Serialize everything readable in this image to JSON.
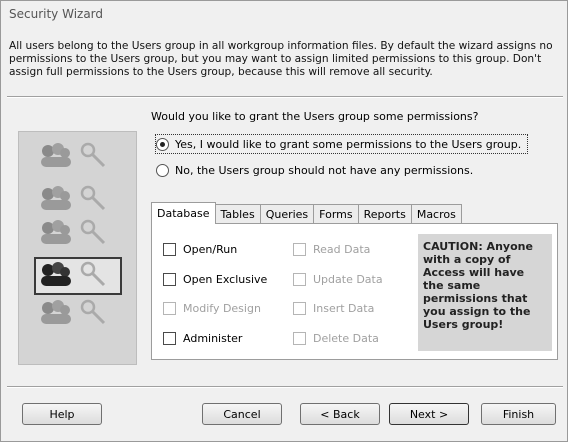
{
  "window": {
    "title": "Security Wizard"
  },
  "intro_text": "All users belong to the Users group in all workgroup information files. By default the wizard assigns no permissions to the Users group, but you may want to assign limited permissions to this group. Don't assign full permissions to the Users group, because this will remove all security.",
  "question": "Would you like to grant the Users group some permissions?",
  "options": {
    "yes": {
      "label": "Yes, I would like to grant some permissions to the Users group.",
      "selected": true
    },
    "no": {
      "label": "No, the Users group should not have any permissions.",
      "selected": false
    }
  },
  "tabs": [
    "Database",
    "Tables",
    "Queries",
    "Forms",
    "Reports",
    "Macros"
  ],
  "active_tab": "Database",
  "permissions": {
    "open_run": "Open/Run",
    "open_exclusive": "Open Exclusive",
    "modify_design": "Modify Design",
    "administer": "Administer",
    "read_data": "Read Data",
    "update_data": "Update Data",
    "insert_data": "Insert Data",
    "delete_data": "Delete Data"
  },
  "caution": "CAUTION: Anyone with a copy of Access will have the same permissions that you assign to the Users group!",
  "buttons": {
    "help": "Help",
    "cancel": "Cancel",
    "back": "< Back",
    "next": "Next >",
    "finish": "Finish"
  }
}
